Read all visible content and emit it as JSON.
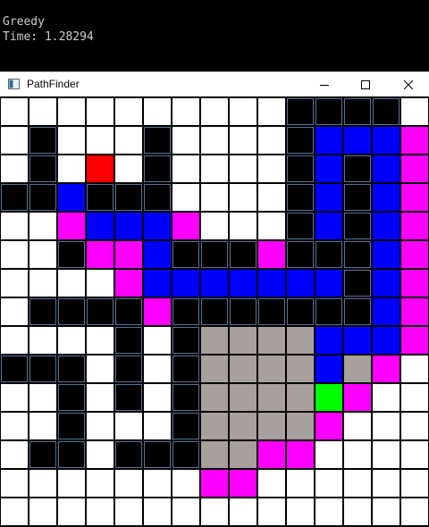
{
  "console": {
    "line1": "Greedy",
    "line2": "Time: 1.28294"
  },
  "window": {
    "title": "PathFinder",
    "buttons": {
      "minimize": "minimize-icon",
      "maximize": "maximize-icon",
      "close": "close-icon"
    }
  },
  "grid": {
    "cols": 15,
    "rows": 15,
    "legend": {
      "0": {
        "name": "empty",
        "color": "#ffffff"
      },
      "1": {
        "name": "wall",
        "color": "#000000"
      },
      "2": {
        "name": "path",
        "color": "#0000ff"
      },
      "3": {
        "name": "frontier",
        "color": "#ff00ff"
      },
      "4": {
        "name": "visited",
        "color": "#a8a09c"
      },
      "5": {
        "name": "start",
        "color": "#00ff00"
      },
      "6": {
        "name": "goal",
        "color": "#ff0000"
      }
    },
    "wall_border": "#5a7296",
    "rows_data": [
      "000000000011110",
      "010001000012223",
      "010601000012123",
      "112111000012123",
      "003222300012123",
      "001332111311123",
      "000032222222123",
      "011113111111123",
      "000010144442223",
      "111010144442430",
      "001010144445300",
      "001000144443000",
      "011011144330000",
      "000000033000000",
      "000000000000000"
    ]
  }
}
